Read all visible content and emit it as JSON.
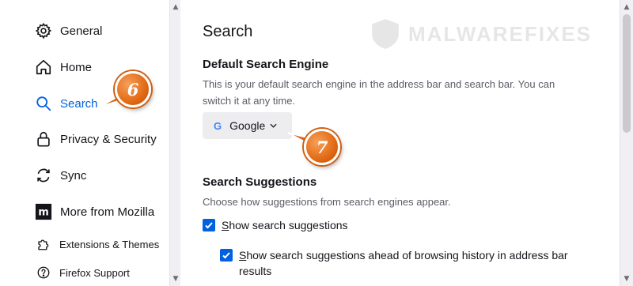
{
  "sidebar": {
    "items": [
      {
        "label": "General",
        "icon": "gear-icon"
      },
      {
        "label": "Home",
        "icon": "home-icon"
      },
      {
        "label": "Search",
        "icon": "search-icon",
        "active": true
      },
      {
        "label": "Privacy & Security",
        "icon": "lock-icon"
      },
      {
        "label": "Sync",
        "icon": "sync-icon"
      },
      {
        "label": "More from Mozilla",
        "icon": "mozilla-icon"
      },
      {
        "label": "Extensions & Themes",
        "icon": "puzzle-icon"
      },
      {
        "label": "Firefox Support",
        "icon": "help-icon"
      }
    ]
  },
  "main": {
    "title": "Search",
    "default_engine": {
      "heading": "Default Search Engine",
      "description_line1": "This is your default search engine in the address bar and search bar. You can",
      "description_line2": "switch it at any time.",
      "selected": "Google",
      "engine_letter": "G"
    },
    "suggestions": {
      "heading": "Search Suggestions",
      "description": "Choose how suggestions from search engines appear.",
      "show_suggestions_prefix": "S",
      "show_suggestions_rest": "how search suggestions",
      "show_suggestions_checked": true,
      "ahead_prefix": "S",
      "ahead_rest_line1": "how search suggestions ahead of browsing history in address bar",
      "ahead_line2": "results",
      "ahead_checked": true
    }
  },
  "watermark": {
    "text": "MALWAREFIXES"
  },
  "annotations": [
    {
      "number": "6"
    },
    {
      "number": "7"
    }
  ],
  "colors": {
    "accent": "#0061e0",
    "badge": "#e26a14"
  }
}
